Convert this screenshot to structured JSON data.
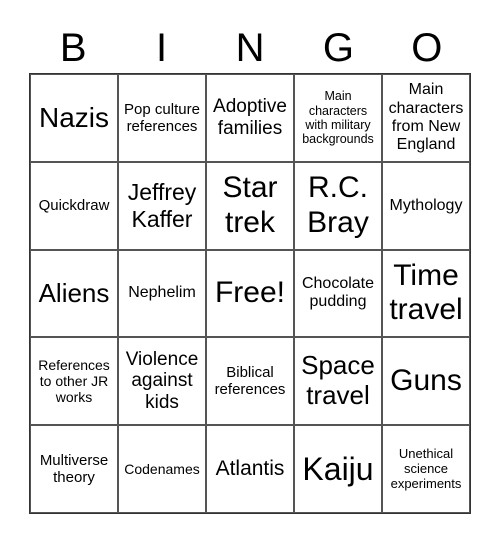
{
  "header": [
    "B",
    "I",
    "N",
    "G",
    "O"
  ],
  "cells": [
    "Nazis",
    "Pop culture references",
    "Adoptive families",
    "Main characters with military backgrounds",
    "Main characters from New England",
    "Quickdraw",
    "Jeffrey Kaffer",
    "Star trek",
    "R.C. Bray",
    "Mythology",
    "Aliens",
    "Nephelim",
    "Free!",
    "Chocolate pudding",
    "Time travel",
    "References to other JR works",
    "Violence against kids",
    "Biblical references",
    "Space travel",
    "Guns",
    "Multiverse theory",
    "Codenames",
    "Atlantis",
    "Kaiju",
    "Unethical science experiments"
  ]
}
